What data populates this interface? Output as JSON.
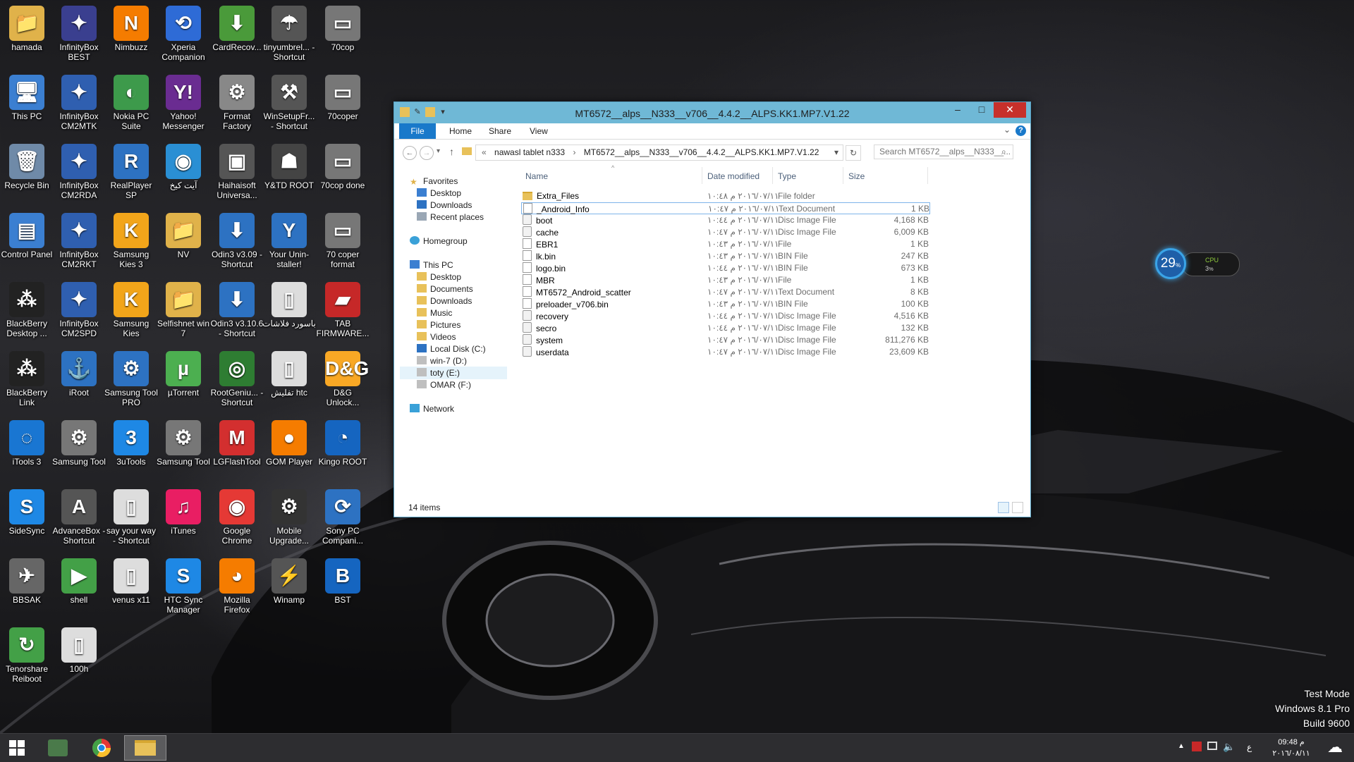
{
  "desktop": {
    "icons": [
      {
        "label": "hamada",
        "glyph": "📁",
        "color": "#e0b24a"
      },
      {
        "label": "InfinityBox BEST",
        "glyph": "✦",
        "color": "#3a3f8f"
      },
      {
        "label": "Nimbuzz",
        "glyph": "N",
        "color": "#f57c00"
      },
      {
        "label": "Xperia Companion",
        "glyph": "⟲",
        "color": "#2e6bd6"
      },
      {
        "label": "CardRecov...",
        "glyph": "⬇",
        "color": "#4a9a3a"
      },
      {
        "label": "tinyumbrel... - Shortcut",
        "glyph": "☂",
        "color": "#555"
      },
      {
        "label": "70cop",
        "glyph": "▭",
        "color": "#777"
      },
      {
        "label": "This PC",
        "glyph": "🖥",
        "color": "#3b7fd1"
      },
      {
        "label": "InfinityBox CM2MTK",
        "glyph": "✦",
        "color": "#2f5fb0"
      },
      {
        "label": "Nokia PC Suite",
        "glyph": "◐",
        "color": "#3d9a4b"
      },
      {
        "label": "Yahoo! Messenger",
        "glyph": "Y!",
        "color": "#6a2c91"
      },
      {
        "label": "Format Factory",
        "glyph": "⚙",
        "color": "#888"
      },
      {
        "label": "WinSetupFr... - Shortcut",
        "glyph": "⚒",
        "color": "#555"
      },
      {
        "label": "70coper",
        "glyph": "▭",
        "color": "#777"
      },
      {
        "label": "Recycle Bin",
        "glyph": "🗑",
        "color": "#6f8aa8"
      },
      {
        "label": "InfinityBox CM2RDA",
        "glyph": "✦",
        "color": "#2f5fb0"
      },
      {
        "label": "RealPlayer SP",
        "glyph": "R",
        "color": "#2d72c2"
      },
      {
        "label": "آيت كيخ",
        "glyph": "◉",
        "color": "#2a8fd4"
      },
      {
        "label": "Haihaisoft Universa...",
        "glyph": "▣",
        "color": "#555"
      },
      {
        "label": "Y&TD ROOT",
        "glyph": "☗",
        "color": "#444"
      },
      {
        "label": "70cop done",
        "glyph": "▭",
        "color": "#777"
      },
      {
        "label": "Control Panel",
        "glyph": "▤",
        "color": "#3b7fd1"
      },
      {
        "label": "InfinityBox CM2RKT",
        "glyph": "✦",
        "color": "#2f5fb0"
      },
      {
        "label": "Samsung Kies 3",
        "glyph": "K",
        "color": "#f2a51a"
      },
      {
        "label": "NV",
        "glyph": "📁",
        "color": "#e0b24a"
      },
      {
        "label": "Odin3 v3.09 - Shortcut",
        "glyph": "⬇",
        "color": "#2d72c2"
      },
      {
        "label": "Your Unin-staller!",
        "glyph": "Y",
        "color": "#2d72c2"
      },
      {
        "label": "70 coper format",
        "glyph": "▭",
        "color": "#777"
      },
      {
        "label": "BlackBerry Desktop ...",
        "glyph": "⁂",
        "color": "#222"
      },
      {
        "label": "InfinityBox CM2SPD",
        "glyph": "✦",
        "color": "#2f5fb0"
      },
      {
        "label": "Samsung Kies",
        "glyph": "K",
        "color": "#f2a51a"
      },
      {
        "label": "Selfishnet win 7",
        "glyph": "📁",
        "color": "#e0b24a"
      },
      {
        "label": "Odin3 v3.10.6 - Shortcut",
        "glyph": "⬇",
        "color": "#2d72c2"
      },
      {
        "label": "باسورد فلاشات",
        "glyph": "▯",
        "color": "#ddd"
      },
      {
        "label": "TAB FIRMWARE...",
        "glyph": "▰",
        "color": "#c62828"
      },
      {
        "label": "BlackBerry Link",
        "glyph": "⁂",
        "color": "#222"
      },
      {
        "label": "iRoot",
        "glyph": "⚓",
        "color": "#2d72c2"
      },
      {
        "label": "Samsung Tool PRO",
        "glyph": "⚙",
        "color": "#2d72c2"
      },
      {
        "label": "µTorrent",
        "glyph": "µ",
        "color": "#4caf50"
      },
      {
        "label": "RootGeniu... - Shortcut",
        "glyph": "◎",
        "color": "#2e7d32"
      },
      {
        "label": "تفليش htc",
        "glyph": "▯",
        "color": "#ddd"
      },
      {
        "label": "D&G Unlock...",
        "glyph": "D&G",
        "color": "#f9a825"
      },
      {
        "label": "iTools 3",
        "glyph": "◌",
        "color": "#1976d2"
      },
      {
        "label": "Samsung Tool",
        "glyph": "⚙",
        "color": "#777"
      },
      {
        "label": "3uTools",
        "glyph": "3",
        "color": "#1e88e5"
      },
      {
        "label": "Samsung Tool",
        "glyph": "⚙",
        "color": "#777"
      },
      {
        "label": "LGFlashTool",
        "glyph": "M",
        "color": "#d32f2f"
      },
      {
        "label": "GOM Player",
        "glyph": "●",
        "color": "#f57c00"
      },
      {
        "label": "Kingo ROOT",
        "glyph": "◔",
        "color": "#1565c0"
      },
      {
        "label": "SideSync",
        "glyph": "S",
        "color": "#1e88e5"
      },
      {
        "label": "AdvanceBox - Shortcut",
        "glyph": "A",
        "color": "#555"
      },
      {
        "label": "say your way - Shortcut",
        "glyph": "▯",
        "color": "#ddd"
      },
      {
        "label": "iTunes",
        "glyph": "♫",
        "color": "#e91e63"
      },
      {
        "label": "Google Chrome",
        "glyph": "◉",
        "color": "#e53935"
      },
      {
        "label": "Mobile Upgrade...",
        "glyph": "⚙",
        "color": "#333"
      },
      {
        "label": "Sony PC Compani...",
        "glyph": "⟳",
        "color": "#2d72c2"
      },
      {
        "label": "BBSAK",
        "glyph": "✈",
        "color": "#666"
      },
      {
        "label": "shell",
        "glyph": "▶",
        "color": "#43a047"
      },
      {
        "label": "venus x11",
        "glyph": "▯",
        "color": "#ddd"
      },
      {
        "label": "HTC Sync Manager",
        "glyph": "S",
        "color": "#1e88e5"
      },
      {
        "label": "Mozilla Firefox",
        "glyph": "◕",
        "color": "#f57c00"
      },
      {
        "label": "Winamp",
        "glyph": "⚡",
        "color": "#555"
      },
      {
        "label": "BST",
        "glyph": "B",
        "color": "#1565c0"
      },
      {
        "label": "Tenorshare Reiboot",
        "glyph": "↻",
        "color": "#43a047"
      },
      {
        "label": "100h",
        "glyph": "▯",
        "color": "#ddd"
      }
    ]
  },
  "window": {
    "title": "MT6572__alps__N333__v706__4.4.2__ALPS.KK1.MP7.V1.22",
    "minimize": "–",
    "maximize": "□",
    "close": "✕",
    "ribbon": {
      "file": "File",
      "home": "Home",
      "share": "Share",
      "view": "View",
      "help": "?"
    },
    "address": {
      "prefix": "«",
      "segment1": "nawasl tablet n333",
      "separator": "›",
      "segment2": "MT6572__alps__N333__v706__4.4.2__ALPS.KK1.MP7.V1.22"
    },
    "search_placeholder": "Search MT6572__alps__N333__...",
    "nav": {
      "favorites": "Favorites",
      "fav_items": [
        "Desktop",
        "Downloads",
        "Recent places"
      ],
      "homegroup": "Homegroup",
      "thispc": "This PC",
      "pc_items": [
        "Desktop",
        "Documents",
        "Downloads",
        "Music",
        "Pictures",
        "Videos",
        "Local Disk (C:)",
        "win-7 (D:)",
        "toty (E:)",
        "OMAR (F:)"
      ],
      "network": "Network"
    },
    "columns": {
      "name": "Name",
      "date": "Date modified",
      "type": "Type",
      "size": "Size"
    },
    "files": [
      {
        "name": "Extra_Files",
        "date": "٢٠١٦/٠٧/١١ م ١٠:٤٨",
        "type": "File folder",
        "size": "",
        "icon": "folder"
      },
      {
        "name": "_Android_Info",
        "date": "٢٠١٦/٠٧/١١ م ١٠:٤٧",
        "type": "Text Document",
        "size": "1 KB",
        "icon": "file"
      },
      {
        "name": "boot",
        "date": "٢٠١٦/٠٧/١١ م ١٠:٤٤",
        "type": "Disc Image File",
        "size": "4,168 KB",
        "icon": "disc"
      },
      {
        "name": "cache",
        "date": "٢٠١٦/٠٧/١١ م ١٠:٤٧",
        "type": "Disc Image File",
        "size": "6,009 KB",
        "icon": "disc"
      },
      {
        "name": "EBR1",
        "date": "٢٠١٦/٠٧/١١ م ١٠:٤٣",
        "type": "File",
        "size": "1 KB",
        "icon": "file"
      },
      {
        "name": "lk.bin",
        "date": "٢٠١٦/٠٧/١١ م ١٠:٤٣",
        "type": "BIN File",
        "size": "247 KB",
        "icon": "file"
      },
      {
        "name": "logo.bin",
        "date": "٢٠١٦/٠٧/١١ م ١٠:٤٤",
        "type": "BIN File",
        "size": "673 KB",
        "icon": "file"
      },
      {
        "name": "MBR",
        "date": "٢٠١٦/٠٧/١١ م ١٠:٤٣",
        "type": "File",
        "size": "1 KB",
        "icon": "file"
      },
      {
        "name": "MT6572_Android_scatter",
        "date": "٢٠١٦/٠٧/١١ م ١٠:٤٧",
        "type": "Text Document",
        "size": "8 KB",
        "icon": "file"
      },
      {
        "name": "preloader_v706.bin",
        "date": "٢٠١٦/٠٧/١١ م ١٠:٤٣",
        "type": "BIN File",
        "size": "100 KB",
        "icon": "file"
      },
      {
        "name": "recovery",
        "date": "٢٠١٦/٠٧/١١ م ١٠:٤٤",
        "type": "Disc Image File",
        "size": "4,516 KB",
        "icon": "disc"
      },
      {
        "name": "secro",
        "date": "٢٠١٦/٠٧/١١ م ١٠:٤٤",
        "type": "Disc Image File",
        "size": "132 KB",
        "icon": "disc"
      },
      {
        "name": "system",
        "date": "٢٠١٦/٠٧/١١ م ١٠:٤٧",
        "type": "Disc Image File",
        "size": "811,276 KB",
        "icon": "disc"
      },
      {
        "name": "userdata",
        "date": "٢٠١٦/٠٧/١١ م ١٠:٤٧",
        "type": "Disc Image File",
        "size": "23,609 KB",
        "icon": "disc"
      }
    ],
    "selected_index": 1,
    "item_count": "14 items"
  },
  "cpu_gadget": {
    "percent": "29",
    "unit": "%",
    "label": "CPU",
    "sub": "3",
    "sub_unit": "%"
  },
  "watermark": {
    "line1": "Test Mode",
    "line2": "Windows 8.1 Pro",
    "line3": "Build 9600"
  },
  "taskbar": {
    "tray_lang": "ع",
    "time": "09:48 م",
    "date": "٢٠١٦/٠٨/١١"
  },
  "colors": {
    "accent": "#1979ca",
    "titlebar": "#6fb8d6",
    "close": "#c7302b",
    "taskbar": "#2d2d30"
  }
}
